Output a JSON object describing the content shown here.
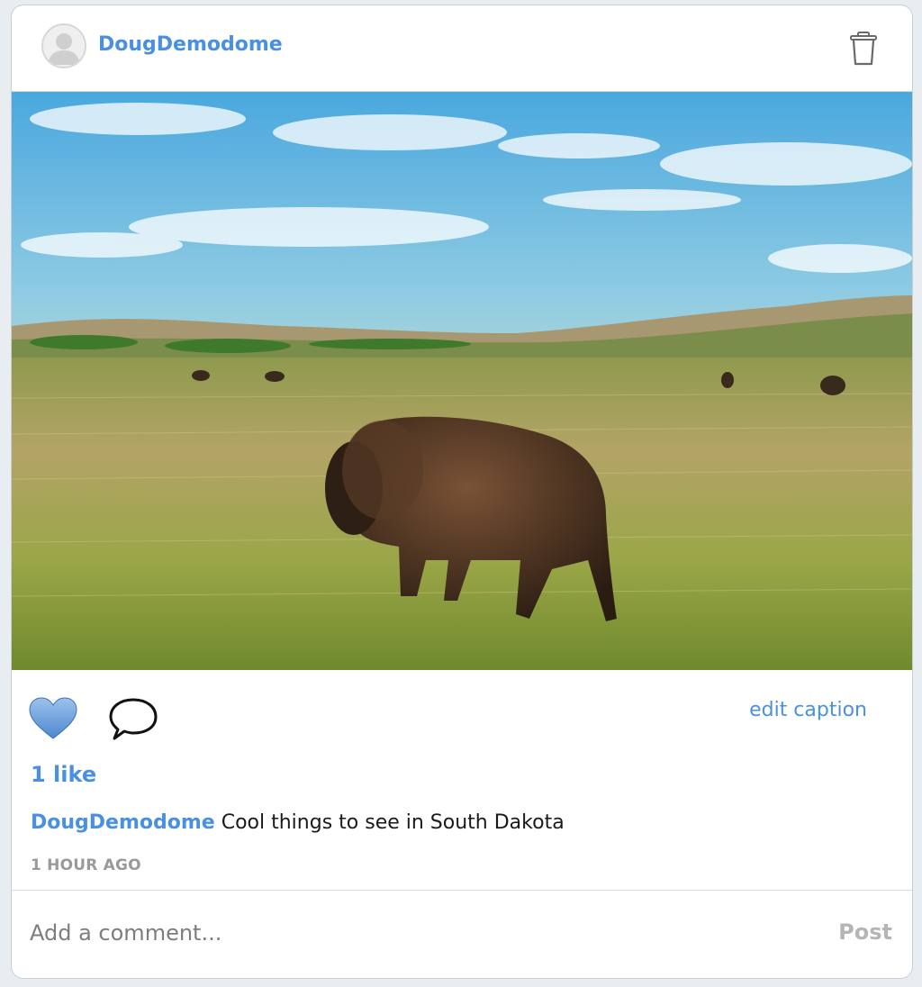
{
  "post": {
    "author": "DougDemodome",
    "caption_author": "DougDemodome",
    "caption_text": "Cool things to see in South Dakota",
    "likes_label": "1 like",
    "edit_caption_label": "edit caption",
    "timestamp": "1 HOUR AGO",
    "image_alt": "bison grazing on a prairie"
  },
  "comment_box": {
    "placeholder": "Add a comment...",
    "post_label": "Post"
  },
  "colors": {
    "accent": "#4a90e2",
    "heart_fill": "#6b9fd8",
    "muted": "#9a9a9a"
  },
  "icons": [
    "avatar-icon",
    "trash-icon",
    "heart-icon",
    "comment-icon"
  ]
}
